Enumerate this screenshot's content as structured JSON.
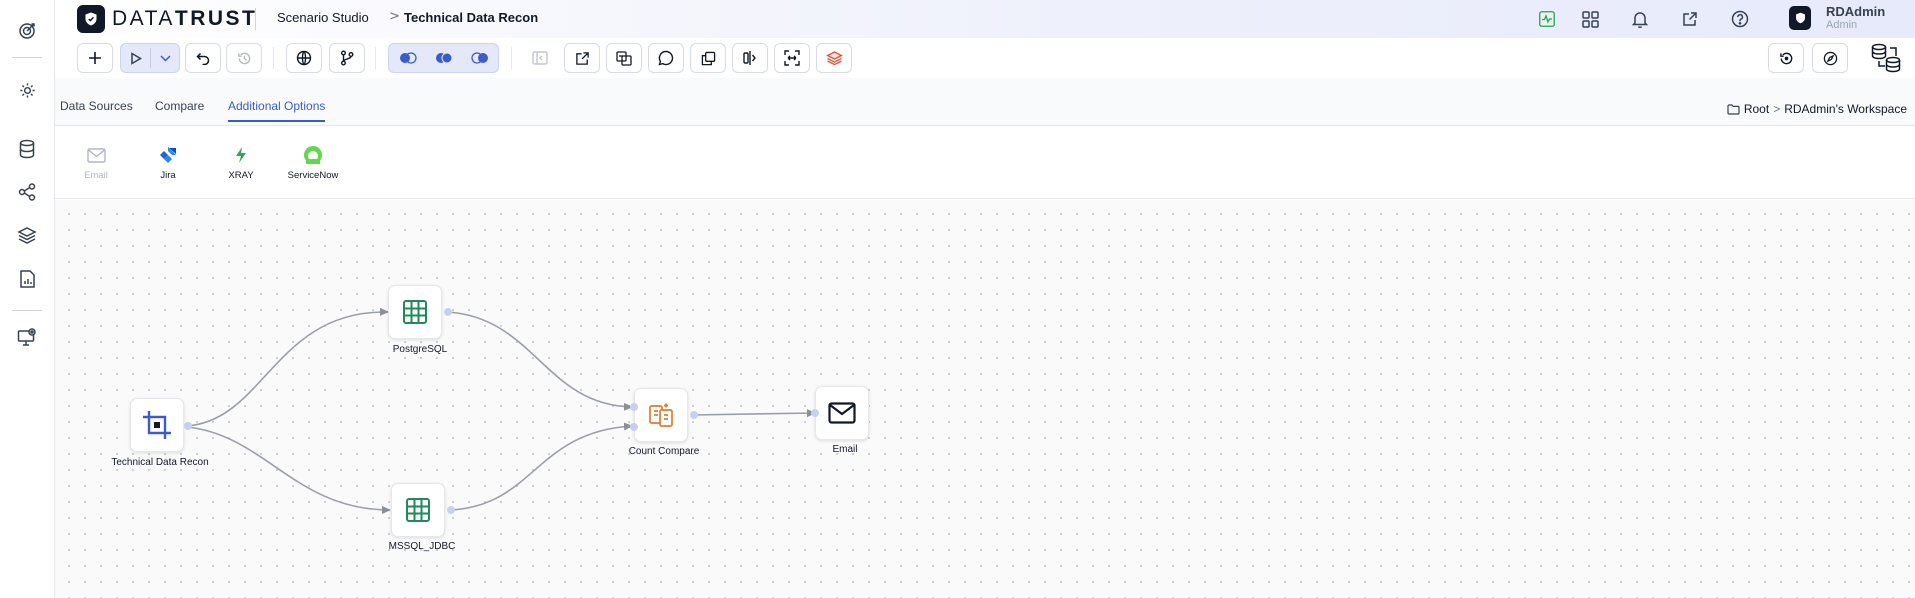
{
  "header": {
    "brand_light": "DATA",
    "brand_bold": "TRUST",
    "breadcrumb": [
      "Scenario Studio",
      "Technical Data Recon"
    ],
    "breadcrumb_sep": ">",
    "user": {
      "name": "RDAdmin",
      "role": "Admin"
    },
    "icons": [
      "activity-icon",
      "apps-grid-icon",
      "bell-icon",
      "external-link-icon",
      "help-icon"
    ]
  },
  "rail": {
    "icons": [
      "target-icon",
      "settings-icon",
      "database-icon",
      "workflow-icon",
      "layers-icon",
      "report-icon",
      "monitor-settings-icon"
    ]
  },
  "toolbar": {
    "buttons": [
      "add",
      "run",
      "run-options",
      "undo",
      "history",
      "globe",
      "branch",
      "compare-left",
      "compare-full",
      "compare-right",
      "collapse",
      "export",
      "import",
      "comment",
      "duplicate",
      "align",
      "fit-view",
      "layers"
    ],
    "right_buttons": [
      "restore",
      "navigate"
    ]
  },
  "tabs": {
    "items": [
      "Data Sources",
      "Compare",
      "Additional Options"
    ],
    "active": "Additional Options"
  },
  "workspace": {
    "path": [
      "Root",
      "RDAdmin's Workspace"
    ],
    "sep": ">"
  },
  "palette": {
    "items": [
      {
        "label": "Email",
        "icon": "mail-icon",
        "enabled": false
      },
      {
        "label": "Jira",
        "icon": "jira-icon",
        "enabled": true
      },
      {
        "label": "XRAY",
        "icon": "xray-icon",
        "enabled": true
      },
      {
        "label": "ServiceNow",
        "icon": "servicenow-icon",
        "enabled": true
      }
    ]
  },
  "canvas": {
    "nodes": [
      {
        "id": "recon",
        "label": "Technical Data Recon",
        "icon": "crop-frame-icon"
      },
      {
        "id": "pg",
        "label": "PostgreSQL",
        "icon": "table-icon"
      },
      {
        "id": "ms",
        "label": "MSSQL_JDBC",
        "icon": "table-icon"
      },
      {
        "id": "cc",
        "label": "Count Compare",
        "icon": "count-compare-icon"
      },
      {
        "id": "email",
        "label": "Email",
        "icon": "envelope-icon"
      }
    ],
    "edges": [
      [
        "recon",
        "pg"
      ],
      [
        "recon",
        "ms"
      ],
      [
        "pg",
        "cc"
      ],
      [
        "ms",
        "cc"
      ],
      [
        "cc",
        "email"
      ]
    ]
  },
  "colors": {
    "accent": "#3b5bcc",
    "table_node": "#1f8a5c",
    "compare_node": "#e07b2c",
    "active_tab": "#3b5bcc"
  }
}
